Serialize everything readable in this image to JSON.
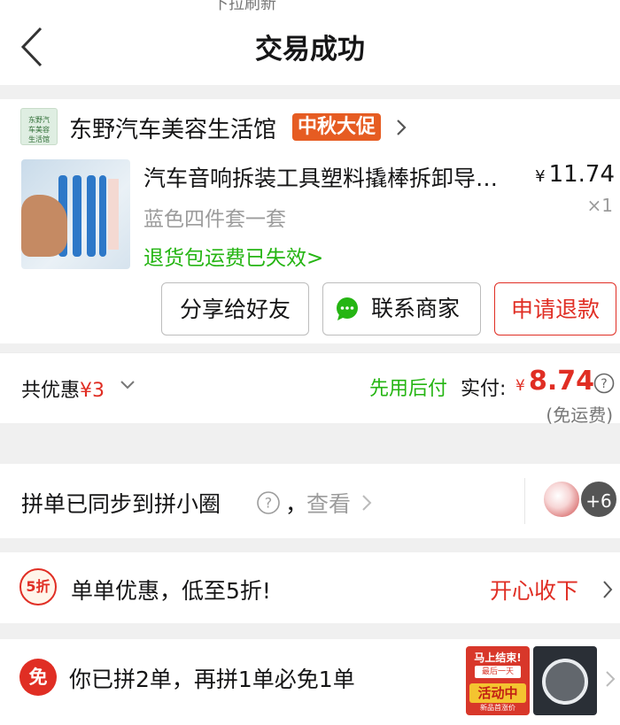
{
  "header": {
    "status_fragment": "下拉刷新",
    "title": "交易成功"
  },
  "store": {
    "logo_text": "东野汽车美容生活馆",
    "name": "东野汽车美容生活馆",
    "tag": "中秋大促"
  },
  "product": {
    "title": "汽车音响拆装工具塑料撬棒拆卸导…",
    "price_symbol": "¥",
    "price": "11.74",
    "spec": "蓝色四件套一套",
    "quantity": "×1",
    "return_note": "退货包运费已失效>"
  },
  "actions": {
    "share": "分享给好友",
    "contact": "联系商家",
    "refund": "申请退款"
  },
  "summary": {
    "discount_label": "共优惠",
    "discount_amount": "¥3",
    "pay_later": "先用后付",
    "paid_label": "实付:",
    "paid_symbol": "¥",
    "paid_amount": "8.74",
    "shipping": "(免运费)"
  },
  "sync": {
    "text": "拼单已同步到拼小圈",
    "comma": "，",
    "view": "查看",
    "more_count": "+6"
  },
  "promo": {
    "badge": "5折",
    "text": "单单优惠，低至5折!",
    "action": "开心收下"
  },
  "free": {
    "badge": "免",
    "text": "你已拼2单，再拼1单必免1单",
    "card_line1": "马上结束!",
    "card_line2": "最后一天",
    "card_line3": "活动中",
    "card_line4": "新品首涨价"
  },
  "colors": {
    "accent_red": "#e02e24",
    "green": "#25b513",
    "tag_orange": "#e65c22",
    "background": "#f0f0f0"
  },
  "icons": {
    "back": "back-arrow-icon",
    "chat": "chat-bubble-icon",
    "help": "question-circle-icon",
    "chevron": "chevron-right-icon"
  }
}
